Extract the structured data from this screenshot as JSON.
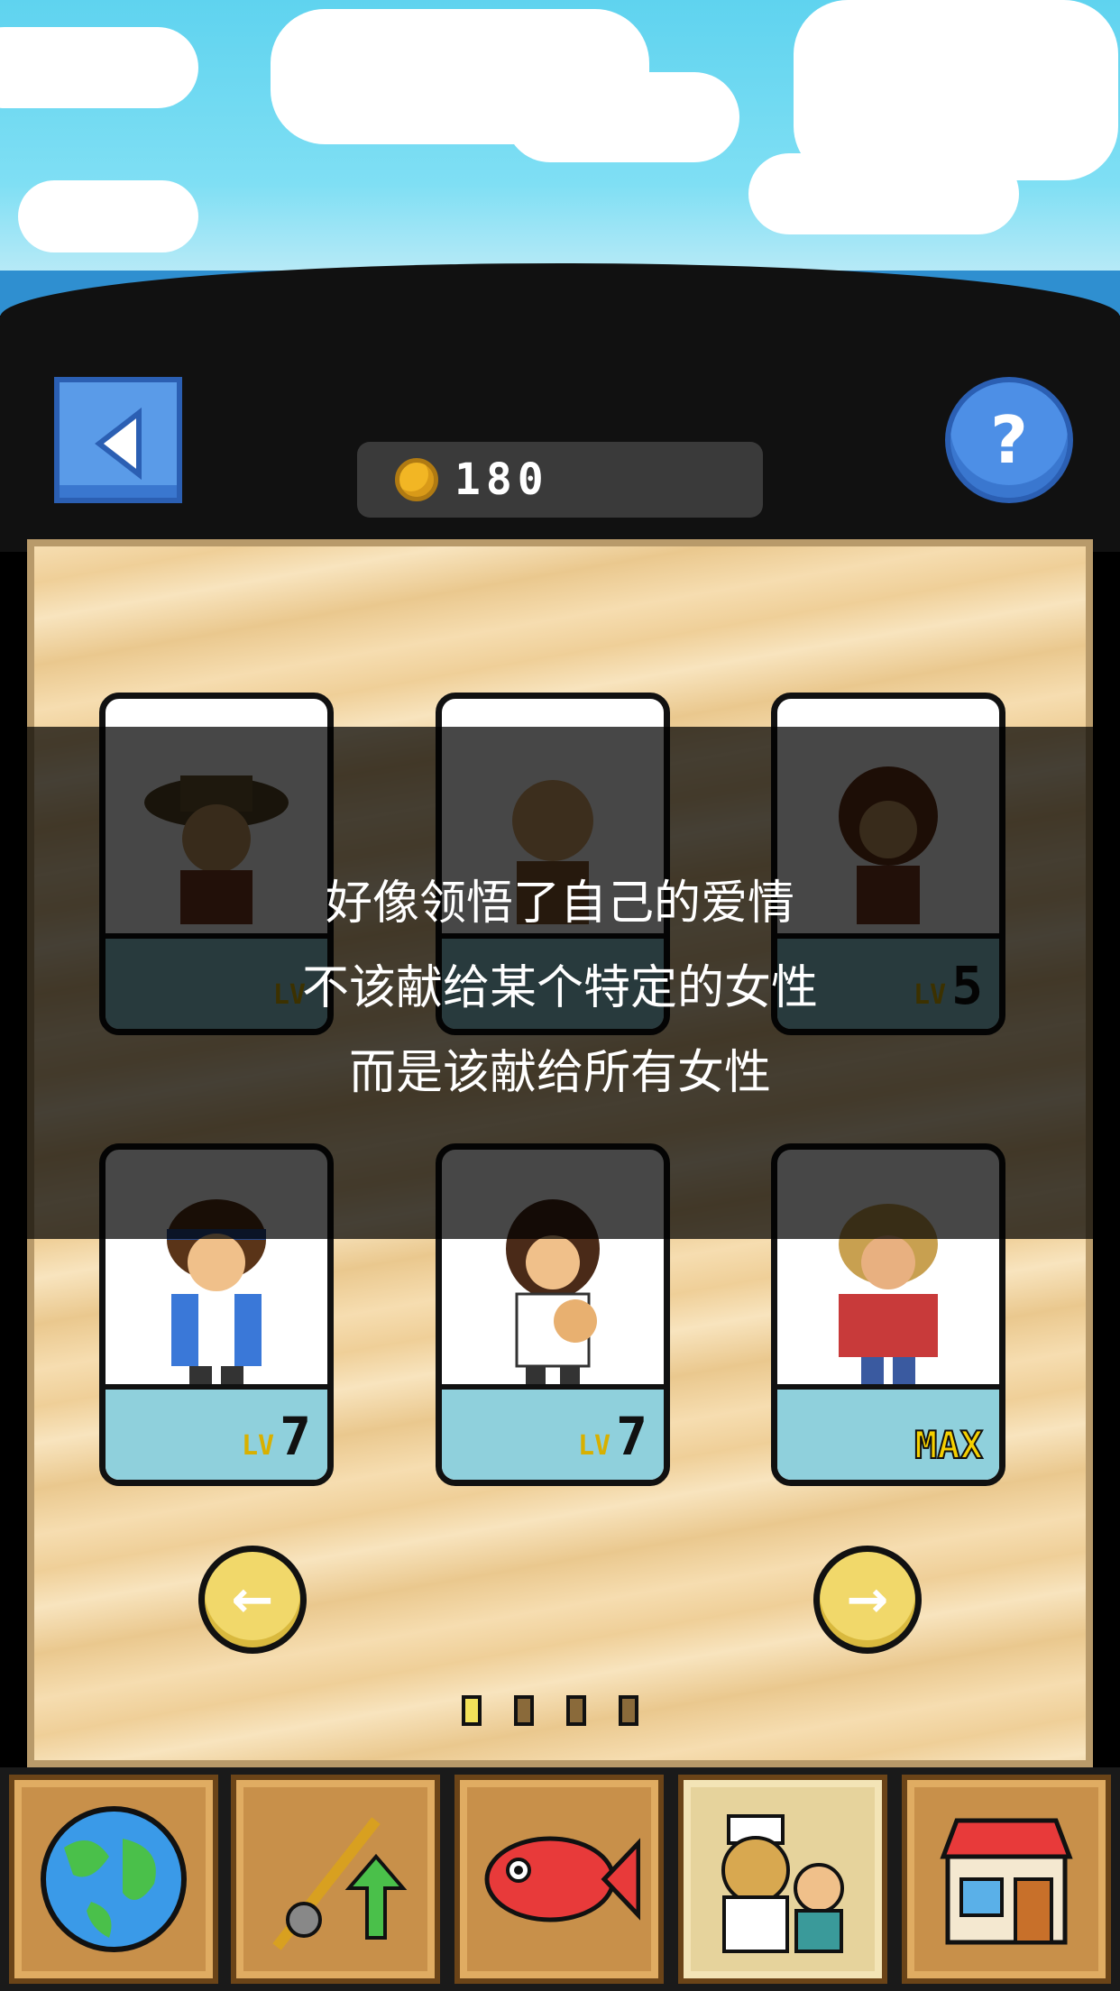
{
  "header": {
    "back_icon": "back-arrow-icon",
    "help_label": "?",
    "coins": "180",
    "coin_icon": "gold-coin-icon"
  },
  "cards": [
    {
      "name": "fisher-hat",
      "level_label": "LV",
      "level": "",
      "dimmed": true
    },
    {
      "name": "bald-man",
      "level_label": "",
      "level": "",
      "dimmed": true
    },
    {
      "name": "brown-hair-woman",
      "level_label": "LV",
      "level": "5",
      "dimmed": true
    },
    {
      "name": "headband-boy",
      "level_label": "LV",
      "level": "7",
      "dimmed": false
    },
    {
      "name": "girl-with-baby",
      "level_label": "LV",
      "level": "7",
      "dimmed": false
    },
    {
      "name": "lumberjack",
      "level_label": "",
      "level": "MAX",
      "dimmed": false
    }
  ],
  "nav": {
    "prev": "←",
    "next": "→"
  },
  "pager": {
    "count": 4,
    "active": 0
  },
  "dialog": {
    "line1": "好像领悟了自己的爱情",
    "line2": "不该献给某个特定的女性",
    "line3": "而是该献给所有女性"
  },
  "tabs": [
    {
      "icon": "globe-icon"
    },
    {
      "icon": "fishing-rod-upgrade-icon"
    },
    {
      "icon": "red-fish-icon"
    },
    {
      "icon": "characters-icon"
    },
    {
      "icon": "shop-icon"
    }
  ],
  "colors": {
    "panel": "#f6ddb0",
    "card_strip": "#8fd0dc",
    "button_blue": "#5a9be8",
    "nav_yellow": "#f1d86a"
  }
}
